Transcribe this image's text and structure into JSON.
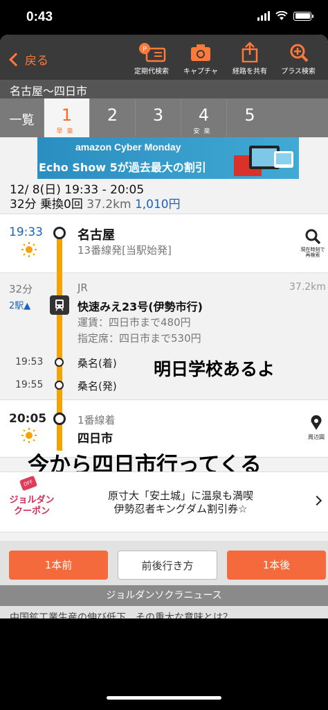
{
  "status": {
    "time": "0:43"
  },
  "toolbar": {
    "back_label": "戻る",
    "tools": [
      "定期代検索",
      "キャプチャ",
      "経路を共有",
      "プラス検索"
    ]
  },
  "route_title": "名古屋〜四日市",
  "tabs": [
    {
      "label": "一覧",
      "sub": ""
    },
    {
      "label": "1",
      "sub": "早楽"
    },
    {
      "label": "2",
      "sub": ""
    },
    {
      "label": "3",
      "sub": ""
    },
    {
      "label": "4",
      "sub": "安楽"
    },
    {
      "label": "5",
      "sub": ""
    }
  ],
  "ad": {
    "line1": "amazon Cyber Monday",
    "line2": "Echo Show 5が過去最大の割引"
  },
  "summary": {
    "line1": "12/ 8(日) 19:33 - 20:05",
    "duration": "32分",
    "transfers": "乗換0回",
    "distance": "37.2km",
    "fare": "1,010円"
  },
  "departure": {
    "time": "19:33",
    "station": "名古屋",
    "platform": "13番線発[当駅始発]",
    "action": "現在時刻で再検索"
  },
  "segment": {
    "duration": "32分",
    "stops": "2駅▲",
    "operator": "JR",
    "distance": "37.2km",
    "train": "快速みえ23号(伊勢市行)",
    "fare": "運賃：四日市まで480円",
    "reserved": "指定席：四日市まで530円"
  },
  "stops": [
    {
      "time": "19:53",
      "name": "桑名(着)"
    },
    {
      "time": "19:55",
      "name": "桑名(発)"
    }
  ],
  "arrival": {
    "time": "20:05",
    "platform": "1番線着",
    "station": "四日市",
    "action": "周辺図"
  },
  "overlay": {
    "caption1": "明日学校あるよ",
    "caption2": "今から四日市行ってくる"
  },
  "coupon": {
    "badge": "OFF",
    "brand1": "ジョルダン",
    "brand2": "クーポン",
    "text1": "原寸大「安土城」に温泉も満喫",
    "text2": "伊勢忍者キングダム割引券☆"
  },
  "buttons": {
    "prev": "1本前",
    "around": "前後行き方",
    "next": "1本後"
  },
  "news": {
    "title": "ジョルダンソクラニュース",
    "ticker": "中国鉱工業生産の伸び低下、その重大な意味とは？"
  },
  "colors": {
    "accent": "#f56a3c",
    "route_line": "#f5a300",
    "link_blue": "#1b62b8"
  }
}
